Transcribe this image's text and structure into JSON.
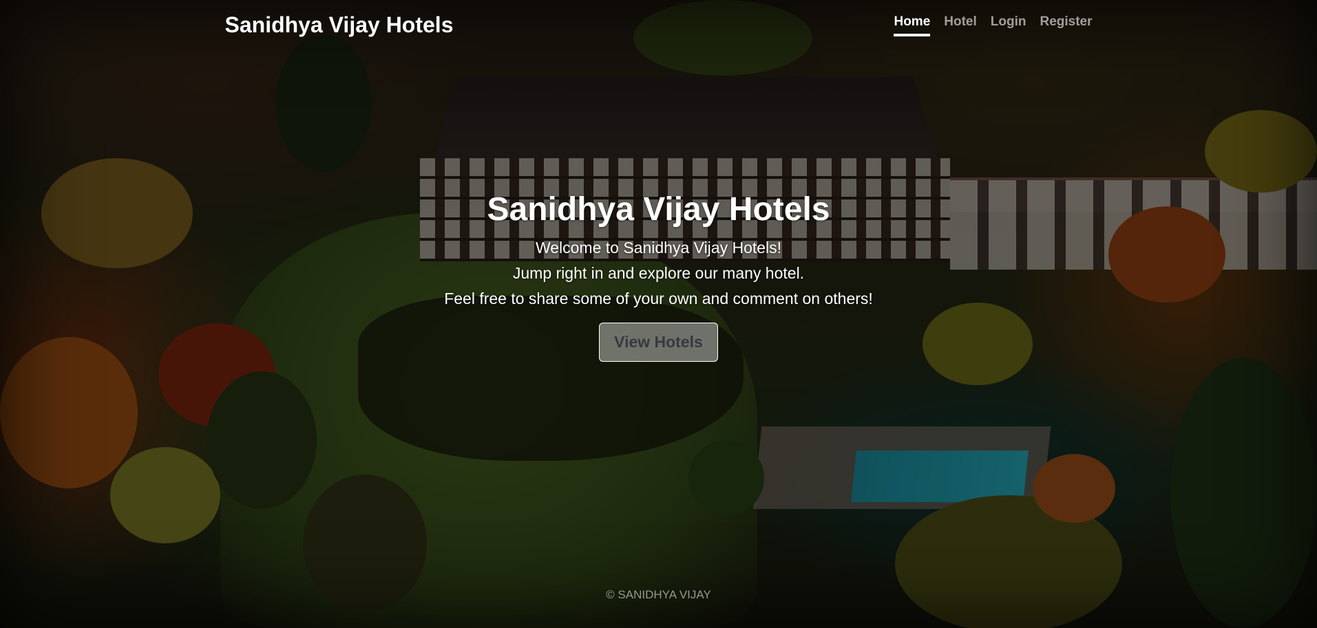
{
  "brand": "Sanidhya Vijay Hotels",
  "nav": {
    "items": [
      {
        "label": "Home",
        "active": true
      },
      {
        "label": "Hotel",
        "active": false
      },
      {
        "label": "Login",
        "active": false
      },
      {
        "label": "Register",
        "active": false
      }
    ]
  },
  "hero": {
    "heading": "Sanidhya Vijay Hotels",
    "lines": [
      "Welcome to Sanidhya Vijay Hotels!",
      "Jump right in and explore our many hotel.",
      "Feel free to share some of your own and comment on others!"
    ],
    "button_label": "View Hotels"
  },
  "footer": {
    "text": "© SANIDHYA VIJAY"
  },
  "colors": {
    "overlay": "#000000",
    "button_text": "#343a40",
    "pool": "#2bc4d4"
  }
}
